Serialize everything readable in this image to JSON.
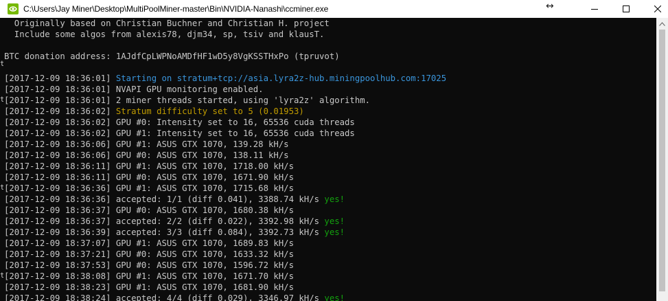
{
  "window": {
    "title": "C:\\Users\\Jay Miner\\Desktop\\MultiPoolMiner-master\\Bin\\NVIDIA-Nanashi\\ccminer.exe",
    "app_icon": "nvidia-icon",
    "buttons": {
      "minimize": "minimize-icon",
      "maximize": "maximize-icon",
      "close": "close-icon"
    }
  },
  "colors": {
    "console_bg": "#0c0c0c",
    "text": "#c8c8c8",
    "info_blue": "#3a96dd",
    "warn_yellow": "#c19c00",
    "ok_green": "#13a10e"
  },
  "console": {
    "lines": [
      {
        "segments": [
          {
            "text": "  Originally based on Christian Buchner and Christian H. project"
          }
        ]
      },
      {
        "segments": [
          {
            "text": "  Include some algos from alexis78, djm34, sp, tsiv and klausT."
          }
        ]
      },
      {
        "segments": [
          {
            "text": ""
          }
        ]
      },
      {
        "segments": [
          {
            "text": "BTC donation address: 1AJdfCpLWPNoAMDfHF1wD5y8VgKSSTHxPo (tpruvot)"
          }
        ]
      },
      {
        "segments": [
          {
            "text": ""
          }
        ]
      },
      {
        "segments": [
          {
            "text": "[2017-12-09 18:36:01] "
          },
          {
            "text": "Starting on stratum+tcp://asia.lyra2z-hub.miningpoolhub.com:17025",
            "color": "blue"
          }
        ]
      },
      {
        "segments": [
          {
            "text": "[2017-12-09 18:36:01] NVAPI GPU monitoring enabled."
          }
        ]
      },
      {
        "segments": [
          {
            "text": "[2017-12-09 18:36:01] 2 miner threads started, using 'lyra2z' algorithm."
          }
        ]
      },
      {
        "segments": [
          {
            "text": "[2017-12-09 18:36:02] "
          },
          {
            "text": "Stratum difficulty set to 5 (0.01953)",
            "color": "yellow"
          }
        ]
      },
      {
        "segments": [
          {
            "text": "[2017-12-09 18:36:02] GPU #0: Intensity set to 16, 65536 cuda threads"
          }
        ]
      },
      {
        "segments": [
          {
            "text": "[2017-12-09 18:36:02] GPU #1: Intensity set to 16, 65536 cuda threads"
          }
        ]
      },
      {
        "segments": [
          {
            "text": "[2017-12-09 18:36:06] GPU #1: ASUS GTX 1070, 139.28 kH/s"
          }
        ]
      },
      {
        "segments": [
          {
            "text": "[2017-12-09 18:36:06] GPU #0: ASUS GTX 1070, 138.11 kH/s"
          }
        ]
      },
      {
        "segments": [
          {
            "text": "[2017-12-09 18:36:11] GPU #1: ASUS GTX 1070, 1718.00 kH/s"
          }
        ]
      },
      {
        "segments": [
          {
            "text": "[2017-12-09 18:36:11] GPU #0: ASUS GTX 1070, 1671.90 kH/s"
          }
        ]
      },
      {
        "segments": [
          {
            "text": "[2017-12-09 18:36:36] GPU #1: ASUS GTX 1070, 1715.68 kH/s"
          }
        ]
      },
      {
        "segments": [
          {
            "text": "[2017-12-09 18:36:36] accepted: 1/1 (diff 0.041), 3388.74 kH/s "
          },
          {
            "text": "yes!",
            "color": "green"
          }
        ]
      },
      {
        "segments": [
          {
            "text": "[2017-12-09 18:36:37] GPU #0: ASUS GTX 1070, 1680.38 kH/s"
          }
        ]
      },
      {
        "segments": [
          {
            "text": "[2017-12-09 18:36:37] accepted: 2/2 (diff 0.022), 3392.98 kH/s "
          },
          {
            "text": "yes!",
            "color": "green"
          }
        ]
      },
      {
        "segments": [
          {
            "text": "[2017-12-09 18:36:39] accepted: 3/3 (diff 0.084), 3392.73 kH/s "
          },
          {
            "text": "yes!",
            "color": "green"
          }
        ]
      },
      {
        "segments": [
          {
            "text": "[2017-12-09 18:37:07] GPU #1: ASUS GTX 1070, 1689.83 kH/s"
          }
        ]
      },
      {
        "segments": [
          {
            "text": "[2017-12-09 18:37:21] GPU #0: ASUS GTX 1070, 1633.32 kH/s"
          }
        ]
      },
      {
        "segments": [
          {
            "text": "[2017-12-09 18:37:53] GPU #0: ASUS GTX 1070, 1596.72 kH/s"
          }
        ]
      },
      {
        "segments": [
          {
            "text": "[2017-12-09 18:38:08] GPU #1: ASUS GTX 1070, 1671.70 kH/s"
          }
        ]
      },
      {
        "segments": [
          {
            "text": "[2017-12-09 18:38:23] GPU #1: ASUS GTX 1070, 1681.90 kH/s"
          }
        ]
      },
      {
        "segments": [
          {
            "text": "[2017-12-09 18:38:24] accepted: 4/4 (diff 0.029), 3346.97 kH/s "
          },
          {
            "text": "yes!",
            "color": "green"
          }
        ]
      }
    ]
  },
  "left_margin_artifacts": [
    "t",
    "t",
    "t",
    "t"
  ],
  "scrollbar": {
    "up_icon": "scroll-up-arrow-icon"
  }
}
